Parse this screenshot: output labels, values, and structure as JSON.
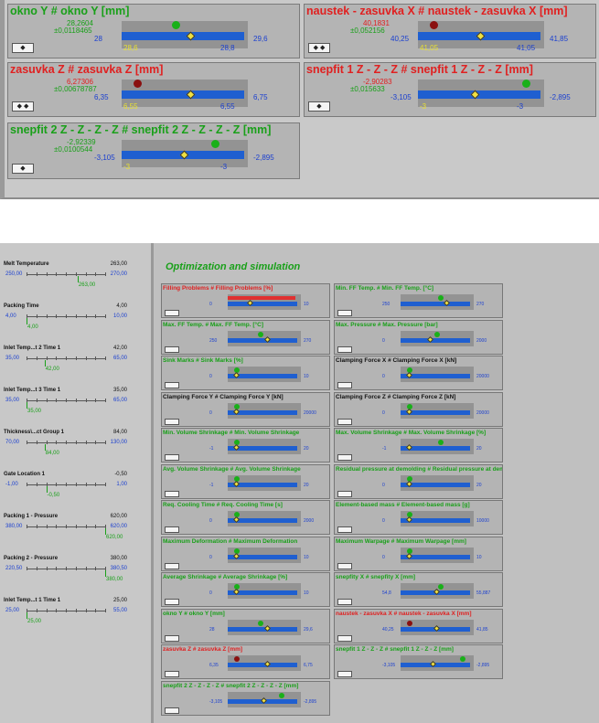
{
  "colors": {
    "green": "#19a019",
    "red": "#e02020",
    "blue": "#1f5fd0",
    "panel": "#b4b4b4",
    "track": "#939393"
  },
  "top_panels": [
    {
      "title": "okno Y # okno Y [mm]",
      "color": "green",
      "value": "28,2604",
      "tol": "±0,0118465",
      "min": "28",
      "cur": "28,6",
      "max": "29,6",
      "max2": "28,8",
      "btn": "◆",
      "dot": "g",
      "level": 0.42,
      "dia": 0.55
    },
    {
      "title": "naustek - zasuvka X # naustek - zasuvka X [mm]",
      "color": "red",
      "value": "40,1831",
      "tol": "±0,052156",
      "min": "40,25",
      "cur": "41,05",
      "max": "41,85",
      "max2": "41,05",
      "btn": "◆ ◆",
      "dot": "r",
      "level": 0.1,
      "dia": 0.5
    },
    {
      "title": "zasuvka Z # zasuvka Z [mm]",
      "color": "red",
      "value": "6,27306",
      "tol": "±0,00678787",
      "min": "6,35",
      "cur": "6,55",
      "max": "6,75",
      "max2": "6,55",
      "btn": "◆ ◆",
      "dot": "r",
      "level": 0.1,
      "dia": 0.55
    },
    {
      "title": "snepfit 1 Z - Z - Z # snepfit 1 Z - Z - Z [mm]",
      "color": "red",
      "value": "-2,90283",
      "tol": "±0,015633",
      "min": "-3,105",
      "cur": "-3",
      "max": "-2,895",
      "max2": "-3",
      "btn": "◆",
      "dot": "g",
      "level": 0.88,
      "dia": 0.45
    },
    {
      "title": "snepfit 2 Z - Z - Z - Z # snepfit 2 Z - Z - Z - Z [mm]",
      "color": "green",
      "value": "-2,92339",
      "tol": "±0,0100544",
      "min": "-3,105",
      "cur": "-3",
      "max": "-2,895",
      "max2": "-3",
      "btn": "◆",
      "dot": "g",
      "level": 0.75,
      "dia": 0.5
    }
  ],
  "sidebar": [
    {
      "label": "Melt Temperature",
      "value": "263,00",
      "min": "250,00",
      "max": "270,00",
      "cur": "263,00",
      "pos": 0.65
    },
    {
      "label": "Packing Time",
      "value": "4,00",
      "min": "4,00",
      "max": "10,00",
      "cur": "4,00",
      "pos": 0.0
    },
    {
      "label": "Inlet Temp...t 2 Time 1",
      "value": "42,00",
      "min": "35,00",
      "max": "65,00",
      "cur": "42,00",
      "pos": 0.23
    },
    {
      "label": "Inlet Temp...t 3 Time 1",
      "value": "35,00",
      "min": "35,00",
      "max": "65,00",
      "cur": "35,00",
      "pos": 0.0
    },
    {
      "label": "Thickness\\...ct Group 1",
      "value": "84,00",
      "min": "70,00",
      "max": "130,00",
      "cur": "84,00",
      "pos": 0.23
    },
    {
      "label": "Gate Location 1",
      "value": "-0,50",
      "min": "-1,00",
      "max": "1,00",
      "cur": "-0,50",
      "pos": 0.25
    },
    {
      "label": "Packing 1 - Pressure",
      "value": "620,00",
      "min": "380,00",
      "max": "620,00",
      "cur": "620,00",
      "pos": 1.0
    },
    {
      "label": "Packing 2 - Pressure",
      "value": "380,00",
      "min": "220,50",
      "max": "380,50",
      "cur": "380,00",
      "pos": 1.0
    },
    {
      "label": "Inlet Temp...t 1 Time 1",
      "value": "25,00",
      "min": "25,00",
      "max": "55,00",
      "cur": "25,00",
      "pos": 0.0
    }
  ],
  "opt_title": "Optimization and simulation",
  "mini_panels": [
    {
      "title": "Filling Problems # Filling Problems [%]",
      "color": "red",
      "min": "0",
      "max": "10",
      "dot": "none",
      "redbar": true,
      "level": 0.6,
      "dia": 0.3
    },
    {
      "title": "Min. FF Temp. # Min. FF Temp. [°C]",
      "color": "green",
      "min": "250",
      "max": "270",
      "dot": "g",
      "level": 0.55,
      "dia": 0.65
    },
    {
      "title": "Max. FF Temp. # Max. FF Temp. [°C]",
      "color": "green",
      "min": "250",
      "max": "270",
      "dot": "g",
      "level": 0.45,
      "dia": 0.55
    },
    {
      "title": "Max. Pressure # Max. Pressure [bar]",
      "color": "green",
      "min": "0",
      "max": "2000",
      "dot": "g",
      "level": 0.5,
      "dia": 0.4
    },
    {
      "title": "Sink Marks # Sink Marks [%]",
      "color": "green",
      "min": "0",
      "max": "10",
      "dot": "g",
      "level": 0.1,
      "dia": 0.1
    },
    {
      "title": "Clamping Force X # Clamping Force X [kN]",
      "color": "black",
      "min": "0",
      "max": "20000",
      "dot": "g",
      "level": 0.1,
      "dia": 0.1
    },
    {
      "title": "Clamping Force Y # Clamping Force Y [kN]",
      "color": "black",
      "min": "0",
      "max": "20000",
      "dot": "g",
      "level": 0.1,
      "dia": 0.1
    },
    {
      "title": "Clamping Force Z # Clamping Force Z [kN]",
      "color": "black",
      "min": "0",
      "max": "20000",
      "dot": "g",
      "level": 0.1,
      "dia": 0.1
    },
    {
      "title": "Min. Volume Shrinkage # Min. Volume Shrinkage",
      "color": "green",
      "min": "-1",
      "max": "20",
      "dot": "g",
      "level": 0.1,
      "dia": 0.1
    },
    {
      "title": "Max. Volume Shrinkage # Max. Volume Shrinkage [%]",
      "color": "green",
      "min": "-1",
      "max": "20",
      "dot": "g",
      "level": 0.55,
      "dia": 0.1
    },
    {
      "title": "Avg. Volume Shrinkage # Avg. Volume Shrinkage",
      "color": "green",
      "min": "-1",
      "max": "20",
      "dot": "g",
      "level": 0.1,
      "dia": 0.1
    },
    {
      "title": "Residual pressure at demolding # Residual pressure at demolding [bar]",
      "color": "green",
      "min": "0",
      "max": "20",
      "dot": "g",
      "level": 0.1,
      "dia": 0.1
    },
    {
      "title": "Req. Cooling Time # Req. Cooling Time [s]",
      "color": "green",
      "min": "0",
      "max": "2000",
      "dot": "g",
      "level": 0.1,
      "dia": 0.1
    },
    {
      "title": "Element-based mass # Element-based mass [g]",
      "color": "green",
      "min": "0",
      "max": "10000",
      "dot": "g",
      "level": 0.1,
      "dia": 0.1
    },
    {
      "title": "Maximum Deformation # Maximum Deformation",
      "color": "green",
      "min": "0",
      "max": "10",
      "dot": "g",
      "level": 0.1,
      "dia": 0.1
    },
    {
      "title": "Maximum Warpage # Maximum Warpage [mm]",
      "color": "green",
      "min": "0",
      "max": "10",
      "dot": "g",
      "level": 0.1,
      "dia": 0.1
    },
    {
      "title": "Average Shrinkage # Average Shrinkage [%]",
      "color": "green",
      "min": "0",
      "max": "10",
      "dot": "g",
      "level": 0.1,
      "dia": 0.1
    },
    {
      "title": "snepfity X # snepfity X [mm]",
      "color": "green",
      "min": "54,8",
      "max": "55,887",
      "dot": "g",
      "level": 0.55,
      "dia": 0.5
    },
    {
      "title": "okno Y # okno Y [mm]",
      "color": "green",
      "min": "28",
      "max": "29,6",
      "dot": "g",
      "level": 0.45,
      "dia": 0.55
    },
    {
      "title": "naustek - zasuvka X # naustek - zasuvka X [mm]",
      "color": "red",
      "min": "40,25",
      "max": "41,85",
      "dot": "r",
      "level": 0.1,
      "dia": 0.5
    },
    {
      "title": "zasuvka Z # zasuvka Z [mm]",
      "color": "red",
      "min": "6,35",
      "max": "6,75",
      "dot": "r",
      "level": 0.1,
      "dia": 0.55
    },
    {
      "title": "snepfit 1 Z - Z - Z # snepfit 1 Z - Z - Z [mm]",
      "color": "green",
      "min": "-3,105",
      "max": "-2,895",
      "dot": "g",
      "level": 0.88,
      "dia": 0.45
    },
    {
      "title": "snepfit 2 Z - Z - Z - Z # snepfit 2 Z - Z - Z - Z [mm]",
      "color": "green",
      "min": "-3,105",
      "max": "-2,895",
      "dot": "g",
      "level": 0.75,
      "dia": 0.5
    }
  ]
}
